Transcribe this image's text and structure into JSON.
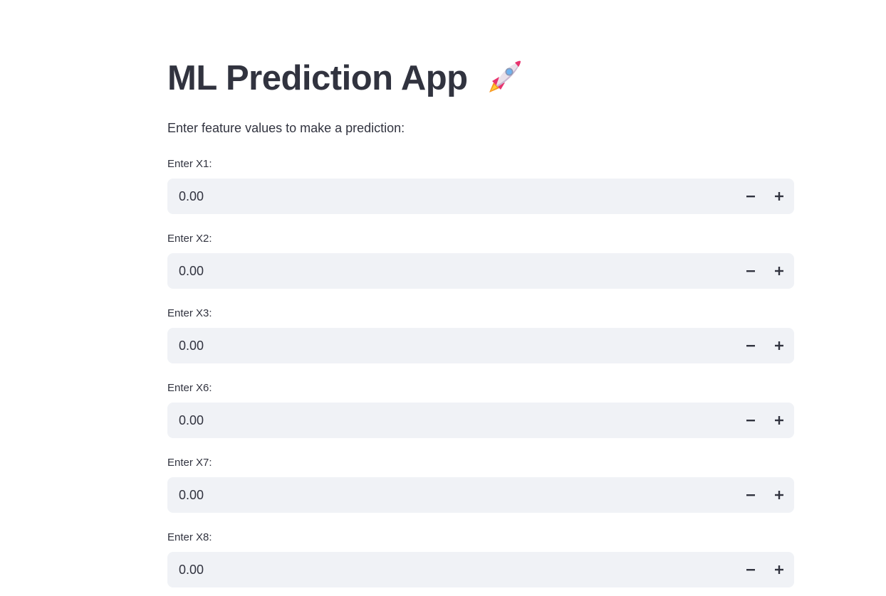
{
  "header": {
    "title": "ML Prediction App",
    "title_icon": "rocket-icon",
    "subtitle": "Enter feature values to make a prediction:"
  },
  "fields": [
    {
      "label": "Enter X1:",
      "value": "0.00"
    },
    {
      "label": "Enter X2:",
      "value": "0.00"
    },
    {
      "label": "Enter X3:",
      "value": "0.00"
    },
    {
      "label": "Enter X6:",
      "value": "0.00"
    },
    {
      "label": "Enter X7:",
      "value": "0.00"
    },
    {
      "label": "Enter X8:",
      "value": "0.00"
    }
  ],
  "colors": {
    "text": "#31333f",
    "input_background": "#f0f2f6",
    "page_background": "#ffffff"
  },
  "icons": {
    "decrement": "minus-icon",
    "increment": "plus-icon"
  }
}
